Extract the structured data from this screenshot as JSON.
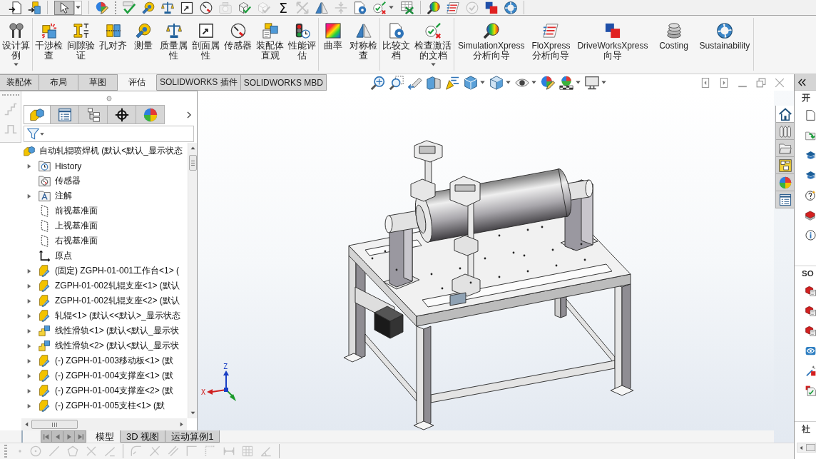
{
  "quick_toolbar": {
    "select_tool": {
      "selected": true
    },
    "sum_symbol": "Σ"
  },
  "command_manager": {
    "groups": [
      {
        "buttons": [
          {
            "kind": "study",
            "lines": [
              "设计算",
              "例"
            ],
            "dropdown": true
          }
        ]
      },
      {
        "buttons": [
          {
            "kind": "interference",
            "lines": [
              "干涉检",
              "查"
            ],
            "dropdown": false
          },
          {
            "kind": "clearance",
            "lines": [
              "间隙验",
              "证"
            ],
            "dropdown": false
          },
          {
            "kind": "holes",
            "lines": [
              "孔对齐"
            ],
            "dropdown": false
          },
          {
            "kind": "measure",
            "lines": [
              "测量"
            ],
            "dropdown": false
          },
          {
            "kind": "mass",
            "lines": [
              "质量属",
              "性"
            ],
            "dropdown": false
          },
          {
            "kind": "section",
            "lines": [
              "剖面属",
              "性"
            ],
            "dropdown": false
          },
          {
            "kind": "sensor",
            "lines": [
              "传感器"
            ],
            "dropdown": false
          },
          {
            "kind": "visualize",
            "lines": [
              "装配体",
              "直观"
            ],
            "dropdown": false
          },
          {
            "kind": "performance",
            "lines": [
              "性能评",
              "估"
            ],
            "dropdown": false
          }
        ]
      },
      {
        "buttons": [
          {
            "kind": "curvature",
            "lines": [
              "曲率"
            ],
            "dropdown": false
          },
          {
            "kind": "symmetry",
            "lines": [
              "对称检",
              "查"
            ],
            "dropdown": false
          }
        ]
      },
      {
        "buttons": [
          {
            "kind": "compare",
            "lines": [
              "比较文",
              "档"
            ],
            "dropdown": false
          },
          {
            "kind": "check",
            "lines": [
              "检查激活",
              "的文档"
            ],
            "dropdown": true
          }
        ]
      },
      {
        "buttons": [
          {
            "kind": "simulation",
            "lines": [
              "SimulationXpress",
              "分析向导"
            ],
            "dropdown": false
          },
          {
            "kind": "flow",
            "lines": [
              "FloXpress",
              "分析向导"
            ],
            "dropdown": false
          },
          {
            "kind": "driveworks",
            "lines": [
              "DriveWorksXpress",
              "向导"
            ],
            "dropdown": false
          },
          {
            "kind": "costing",
            "lines": [
              "Costing"
            ],
            "dropdown": false
          },
          {
            "kind": "sustainability",
            "lines": [
              "Sustainability"
            ],
            "dropdown": false
          }
        ]
      }
    ]
  },
  "command_tabs": [
    {
      "label": "装配体",
      "selected": false
    },
    {
      "label": "布局",
      "selected": false
    },
    {
      "label": "草图",
      "selected": false
    },
    {
      "label": "评估",
      "selected": true
    },
    {
      "label": "SOLIDWORKS 插件",
      "selected": false
    },
    {
      "label": "SOLIDWORKS MBD",
      "selected": false
    }
  ],
  "feature_manager": {
    "tabs": [
      {
        "kind": "tree",
        "selected": true
      },
      {
        "kind": "properties",
        "selected": false
      },
      {
        "kind": "configurations",
        "selected": false
      },
      {
        "kind": "dimxpert",
        "selected": false
      },
      {
        "kind": "display",
        "selected": false
      }
    ],
    "tree": {
      "kind": "assembly",
      "label": "自动轧辊喷焊机 (默认<默认_显示状态",
      "children": [
        {
          "kind": "history",
          "label": "History",
          "expandable": true
        },
        {
          "kind": "sensors",
          "label": "传感器",
          "expandable": false
        },
        {
          "kind": "annotations",
          "label": "注解",
          "expandable": true
        },
        {
          "kind": "plane",
          "label": "前视基准面",
          "expandable": false
        },
        {
          "kind": "plane",
          "label": "上视基准面",
          "expandable": false
        },
        {
          "kind": "plane",
          "label": "右视基准面",
          "expandable": false
        },
        {
          "kind": "origin",
          "label": "原点",
          "expandable": false
        },
        {
          "kind": "part",
          "label": "(固定) ZGPH-01-001工作台<1> (",
          "expandable": true
        },
        {
          "kind": "part",
          "label": "ZGPH-01-002轧辊支座<1> (默认",
          "expandable": true
        },
        {
          "kind": "part",
          "label": "ZGPH-01-002轧辊支座<2> (默认",
          "expandable": true
        },
        {
          "kind": "part",
          "label": "轧辊<1> (默认<<默认>_显示状态",
          "expandable": true
        },
        {
          "kind": "subassembly",
          "label": "线性滑轨<1> (默认<默认_显示状",
          "expandable": true
        },
        {
          "kind": "subassembly",
          "label": "线性滑轨<2> (默认<默认_显示状",
          "expandable": true
        },
        {
          "kind": "part",
          "label": "(-) ZGPH-01-003移动板<1> (默",
          "expandable": true
        },
        {
          "kind": "part",
          "label": "(-) ZGPH-01-004支撑座<1> (默",
          "expandable": true
        },
        {
          "kind": "part",
          "label": "(-) ZGPH-01-004支撑座<2> (默",
          "expandable": true
        },
        {
          "kind": "part",
          "label": "(-) ZGPH-01-005支柱<1> (默",
          "expandable": true
        }
      ]
    }
  },
  "viewport": {
    "triad": {
      "x_label": "X",
      "z_label": "Z"
    }
  },
  "task_pane": {
    "tabs": [
      {
        "kind": "home",
        "selected": true
      },
      {
        "kind": "library",
        "selected": false
      },
      {
        "kind": "explorer",
        "selected": false
      },
      {
        "kind": "palette",
        "selected": false
      },
      {
        "kind": "appearances",
        "selected": false
      },
      {
        "kind": "properties",
        "selected": false
      }
    ],
    "sections": [
      {
        "title": "开"
      },
      {
        "title": "SO"
      },
      {
        "title": "社"
      }
    ]
  },
  "bottom_tabs": [
    {
      "label": "模型",
      "selected": true
    },
    {
      "label": "3D 视图",
      "selected": false
    },
    {
      "label": "运动算例1",
      "selected": false
    }
  ]
}
